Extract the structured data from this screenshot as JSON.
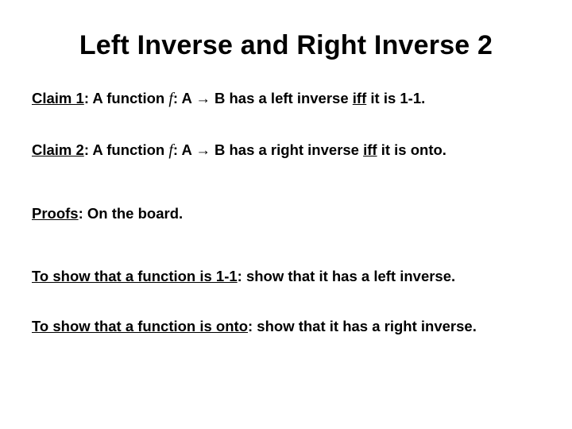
{
  "title": "Left Inverse and Right Inverse 2",
  "claim1": {
    "label": "Claim 1",
    "pre": ": A function ",
    "fn": "f",
    "mid1": ": A ",
    "arrow": "→",
    "mid2": " B has a left inverse ",
    "iff": "iff",
    "tail": " it is 1-1."
  },
  "claim2": {
    "label": "Claim 2",
    "pre": ": A function ",
    "fn": "f",
    "mid1": ": A ",
    "arrow": "→",
    "mid2": " B has a right inverse ",
    "iff": "iff",
    "tail": " it is onto."
  },
  "proofs": {
    "label": "Proofs",
    "text": ": On the board."
  },
  "show1": {
    "u": "To show that a function is 1-1",
    "text": ": show that it has a left inverse."
  },
  "show2": {
    "u": "To show that a function is onto",
    "text": ": show that it has a right inverse."
  }
}
